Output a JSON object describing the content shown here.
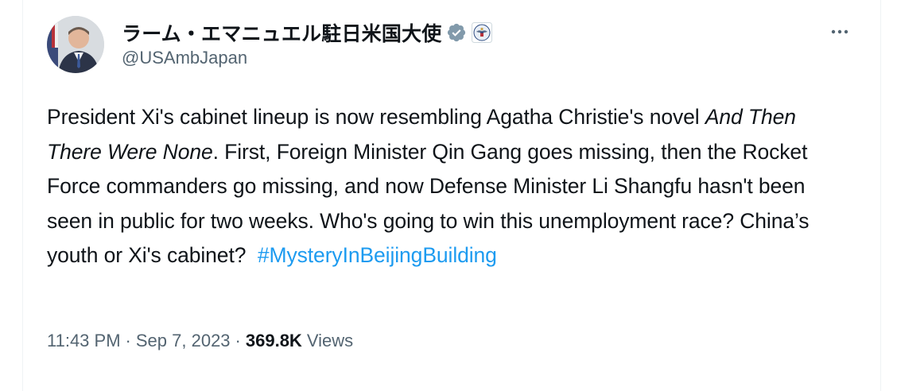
{
  "author": {
    "display_name": "ラーム・エマニュエル駐日米国大使",
    "handle": "@USAmbJapan",
    "avatar_icon": "profile-photo",
    "verified_icon": "verified-badge-icon",
    "affiliation_icon": "us-embassy-seal-icon"
  },
  "tweet": {
    "text_part1": "President Xi's cabinet lineup is now resembling Agatha Christie's novel ",
    "text_italic": "And Then There Were None",
    "text_part2": ". First, Foreign Minister Qin Gang goes missing, then the Rocket Force commanders go missing, and now Defense Minister Li Shangfu hasn't been seen in public for two weeks. Who's going to win this unemployment race? China’s youth or Xi's cabinet?  ",
    "hashtag": "#MysteryInBeijingBuilding"
  },
  "meta": {
    "time": "11:43 PM",
    "separator": "·",
    "date": "Sep 7, 2023",
    "views_count": "369.8K",
    "views_label": "Views"
  },
  "colors": {
    "text": "#0f1419",
    "secondary": "#536471",
    "link": "#1d9bf0",
    "verified_badge": "#829aab"
  }
}
